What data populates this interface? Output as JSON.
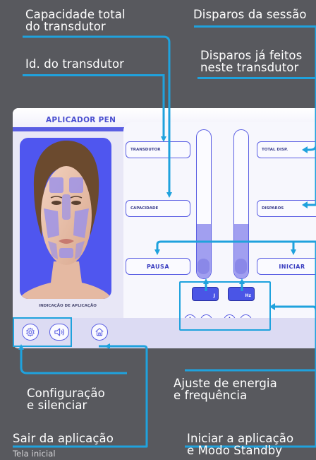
{
  "annotations": {
    "capacity_total": "Capacidade total\ndo transdutor",
    "session_shots": "Disparos da sessão",
    "transducer_id": "Id. do transdutor",
    "shots_done": "Disparos já feitos\nneste transdutor",
    "config_mute": "Configuração\ne silenciar",
    "energy_freq": "Ajuste de energia\ne frequência",
    "exit_app": "Sair da aplicação",
    "home_screen": "Tela inicial",
    "start_standby": "Iniciar a aplicação\ne Modo Standby"
  },
  "screen": {
    "title": "APLICADOR PEN",
    "application_label": "INDICAÇÃO DE APLICAÇÃO",
    "fields": {
      "transducer": "TRANSDUTOR",
      "capacity": "CAPACIDADE",
      "total_shots": "TOTAL DISP.",
      "shots": "DISPAROS"
    },
    "buttons": {
      "pause": "PAUSA",
      "start": "INICIAR",
      "plus": "+",
      "minus": "−"
    },
    "units": {
      "energy": "J",
      "frequency": "Hz"
    }
  },
  "colors": {
    "accent": "#1fa2dd",
    "brand": "#5a5ee3",
    "background": "#58595e"
  },
  "icons": [
    "gear-icon",
    "speaker-icon",
    "home-icon"
  ]
}
